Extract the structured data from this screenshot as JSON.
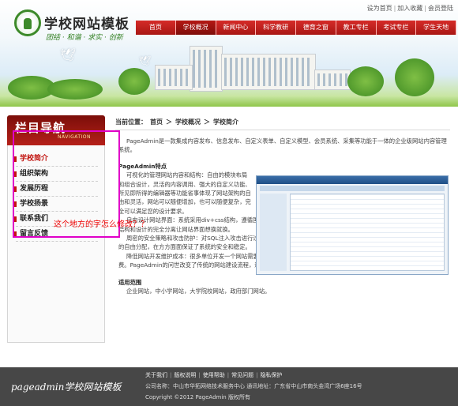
{
  "header": {
    "site_name": "学校网站模板",
    "slogan": "团结 · 和谐 · 求实 · 创新",
    "toplinks": [
      "设为首页",
      "加入收藏",
      "会员登陆"
    ]
  },
  "nav": [
    "首页",
    "学校概况",
    "新闻中心",
    "科学教研",
    "德育之窗",
    "教工专栏",
    "考试专栏",
    "学生天地"
  ],
  "sidebar": {
    "title": "栏目导航",
    "subtitle": "NAVIGATION",
    "items": [
      "学校简介",
      "组织架构",
      "发展历程",
      "学校扬景",
      "联系我们",
      "留言反馈"
    ]
  },
  "breadcrumb": [
    "当前位置：",
    "首页",
    "＞",
    "学校概况",
    "＞",
    "学校简介"
  ],
  "article": {
    "intro": "PageAdmin是一款集成内容发布、信息发布、自定义表单、自定义模型、会员系统、采集等功能于一体的企业级网站内容管理系统。",
    "feature_heading": "PageAdmin特点",
    "feature_text": "可视化的管理网站内容和结构：自由的模块布局和组合设计，灵活的内容调用、强大的自定义功能、所见即所得的编辑器等功能省事体现了网站架构的自由和灵活，网站可以随便增加，也可以随便复杂，完全可以满足您的设计要求。",
    "design_text": "自由设计网站界面：系统采用div+css结构，遵循国际最新W3C网页设计标准，兼容IE6、IE7、火狐、Opera等主流浏览器，结构和设计的完全分离让网站界面想换就换。",
    "security_text": "周密的安全策略和攻击防护：对SQL注入攻击进行过滤、对密码进行了不可逆加密处理，提供数据库备份功能、对管理员权限的自由分配，在方方面面保证了系统的安全和稳定。",
    "cost_text": "降低网站开发维护成本：很多单位开发一个网站需要动用大量的财力物力，我说计公司开发时需要付费，后期维护也需要付费。PageAdmin的问世改变了传统的网站建设流程，通过安装PageAdmin,任何用户都可以轻松的架设和管理自己的网站。",
    "usage_heading": "适用范围",
    "usage_text": "企业网站，中小学网站，大学院校网站，政府部门网站。"
  },
  "annotation": "这个地方的字怎么修改？？",
  "footer": {
    "logo": "pageadmin学校网站模板",
    "links": [
      "关于我们",
      "版权说明",
      "使用帮助",
      "常见问题",
      "隐私保护"
    ],
    "company": "公司名称：中山市华拓网络技术服务中心 通讯地址：广东省中山市南头金湾广场6座16号",
    "copyright": "Copyright ©2012 PageAdmin 版权所有"
  }
}
